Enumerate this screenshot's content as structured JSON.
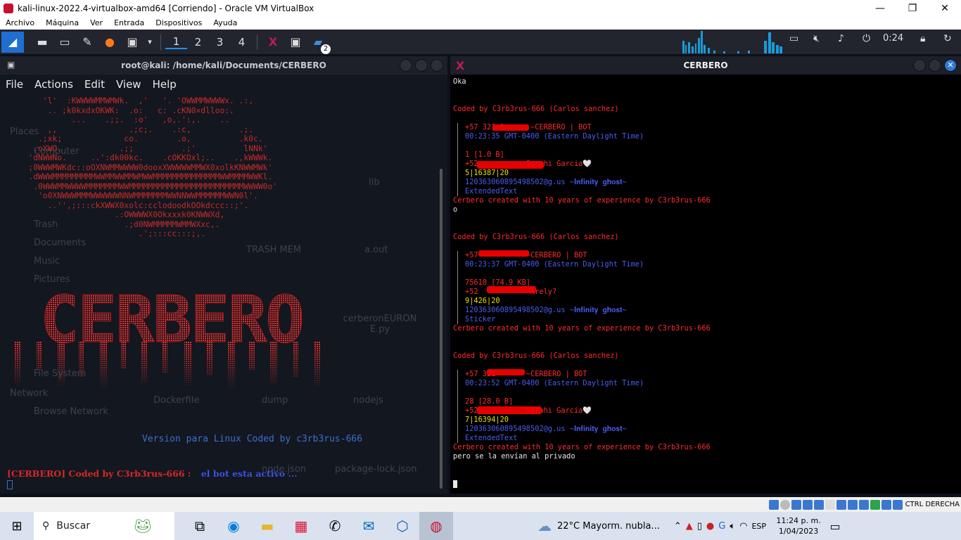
{
  "window": {
    "title": "kali-linux-2022.4-virtualbox-amd64 [Corriendo] - Oracle VM VirtualBox"
  },
  "vb_menu": [
    "Archivo",
    "Máquina",
    "Ver",
    "Entrada",
    "Dispositivos",
    "Ayuda"
  ],
  "kali_panel": {
    "workspaces": [
      "1",
      "2",
      "3",
      "4"
    ],
    "badge": "2",
    "clock": "0:24"
  },
  "left_terminal": {
    "title": "root@kali: /home/kali/Documents/CERBERO",
    "menu": [
      "File",
      "Actions",
      "Edit",
      "View",
      "Help"
    ],
    "ascii_art": [
      "      'l'  :KWWWWMMWMWk.  ,'   '. 'OWWMMWWWWx. .:,",
      "       .. ;k0kxdxOKWK:  .o:   c: .cKN0×dlloo:.",
      "            ...    .;;.  :o'   ,o,.':,.    ..",
      "       ,,               .;c;.    .:c,          .;.",
      "     .;xk;             co.        .o,          .k0c.",
      "    .oXWO.            .;;          .;'          lNNk'",
      "   'dNWWNo.     ..':dk00kc.    .cOKKOxl;..    .,kWWWk.",
      "   ;0WWWMWKdc::oOXNWMMWWWW0dooxXWWWWWMMWX0xolkKNWWMWk'",
      "   .dWWWMMMMMMMMMWWMMWWMMWMWWMMMMMMMMMMMMMMWWMMMMWWKl.",
      "    .0WWWMMWWWWMMMMMMMWWMMMMMMMMMMMMMMMMMMMMMMMMWWWW0o'",
      "     'o0XNWWWMMMWWWWWWNNWMMMMMMMWWNNWWMMMMMMWWN0l'.",
      "       ..'',;:::ckXWWX0xolc:cclodoodkOOkdccc::;'.",
      "                     .:OWWWWX0Okxxxk0KNWWXd,",
      "                       .;d0NWMMMMMWMMWXxc,.",
      "                          .';:::cc:::;,."
    ],
    "banner": "CERBERO",
    "version_line": "Version para Linux Coded by c3rb3rus-666",
    "status_prefix": "[CERBERO] Coded by C3rb3rus-666 :",
    "status_msg": "el bot esta activo ...",
    "ghost_labels": [
      "Places",
      "Computer",
      "Trash",
      "Documents",
      "Music",
      "Pictures",
      "File System",
      "Network",
      "Browse Network",
      "TRASH MEM",
      "a.out",
      "lib",
      "Dockerfile",
      "dump",
      "cerberonEURON E.py",
      "node.json",
      "package-lock.json",
      "nodejs"
    ]
  },
  "right_terminal": {
    "title": "CERBERO",
    "lines": [
      {
        "t": "Oka",
        "c": "wht"
      },
      {
        "t": "",
        "c": "wht"
      },
      {
        "t": "",
        "c": "wht"
      },
      {
        "t": "Coded by C3rb3rus-666 (Carlos sanchez)",
        "c": "red"
      },
      {
        "t": "",
        "c": "wht"
      },
      {
        "t": "+57 321-9      ~CERBERO | BOT",
        "c": "red",
        "bar": true
      },
      {
        "t": "00:23:35 GMT-0400 (Eastern Daylight Time)",
        "c": "blue",
        "bar": true
      },
      {
        "t": "",
        "c": "wht",
        "bar": true
      },
      {
        "t": "1 [1.0 B]",
        "c": "red",
        "bar": true
      },
      {
        "t": "+52           Sarahi Garcia🤍",
        "c": "red",
        "bar": true
      },
      {
        "t": "5|16387|20",
        "c": "yel",
        "bar": true
      },
      {
        "t": "120363060895498502@g.us ~𝐈𝐧𝐟𝐢𝐧𝐢𝐭𝐲 𝐠𝐡𝐨𝐬𝐭~",
        "c": "blue",
        "bar": true
      },
      {
        "t": "ExtendedText",
        "c": "blue",
        "bar": true
      },
      {
        "t": "Cerbero created with 10 years of experience by C3rb3rus-666",
        "c": "red"
      },
      {
        "t": "o",
        "c": "wht"
      },
      {
        "t": "",
        "c": "wht"
      },
      {
        "t": "",
        "c": "wht"
      },
      {
        "t": "Coded by C3rb3rus-666 (Carlos sanchez)",
        "c": "red"
      },
      {
        "t": "",
        "c": "wht"
      },
      {
        "t": "+57           ~CERBERO | BOT",
        "c": "red",
        "bar": true
      },
      {
        "t": "00:23:37 GMT-0400 (Eastern Daylight Time)",
        "c": "blue",
        "bar": true
      },
      {
        "t": "",
        "c": "wht",
        "bar": true
      },
      {
        "t": "75610 [74.9 KB]",
        "c": "red",
        "bar": true
      },
      {
        "t": "+52           ~Arely?",
        "c": "red",
        "bar": true
      },
      {
        "t": "9|426|20",
        "c": "yel",
        "bar": true
      },
      {
        "t": "120363060895498502@g.us ~𝐈𝐧𝐟𝐢𝐧𝐢𝐭𝐲 𝐠𝐡𝐨𝐬𝐭~",
        "c": "blue",
        "bar": true
      },
      {
        "t": "Sticker",
        "c": "blue",
        "bar": true
      },
      {
        "t": "Cerbero created with 10 years of experience by C3rb3rus-666",
        "c": "red"
      },
      {
        "t": "",
        "c": "wht"
      },
      {
        "t": "",
        "c": "wht"
      },
      {
        "t": "Coded by C3rb3rus-666 (Carlos sanchez)",
        "c": "red"
      },
      {
        "t": "",
        "c": "wht"
      },
      {
        "t": "+57 321-      ~CERBERO | BOT",
        "c": "red",
        "bar": true
      },
      {
        "t": "00:23:52 GMT-0400 (Eastern Daylight Time)",
        "c": "blue",
        "bar": true
      },
      {
        "t": "",
        "c": "wht",
        "bar": true
      },
      {
        "t": "28 [28.0 B]",
        "c": "red",
        "bar": true
      },
      {
        "t": "+52           Sarahi Garcia🤍",
        "c": "red",
        "bar": true
      },
      {
        "t": "7|16394|20",
        "c": "yel",
        "bar": true
      },
      {
        "t": "120363060895498502@g.us ~𝐈𝐧𝐟𝐢𝐧𝐢𝐭𝐲 𝐠𝐡𝐨𝐬𝐭~",
        "c": "blue",
        "bar": true
      },
      {
        "t": "ExtendedText",
        "c": "blue",
        "bar": true
      },
      {
        "t": "Cerbero created with 10 years of experience by C3rb3rus-666",
        "c": "red"
      },
      {
        "t": "pero se la envían al privado",
        "c": "wht"
      }
    ]
  },
  "vb_status": {
    "host_key": "CTRL DERECHA"
  },
  "taskbar": {
    "search_placeholder": "Buscar",
    "weather": "22°C  Mayorm. nubla...",
    "lang": "ESP",
    "time": "11:24 p. m.",
    "date": "1/04/2023"
  },
  "colors": {
    "accent_red": "#ff2a2a",
    "blue": "#4a5cf0",
    "yellow": "#e6e000",
    "panel": "#22252e"
  }
}
